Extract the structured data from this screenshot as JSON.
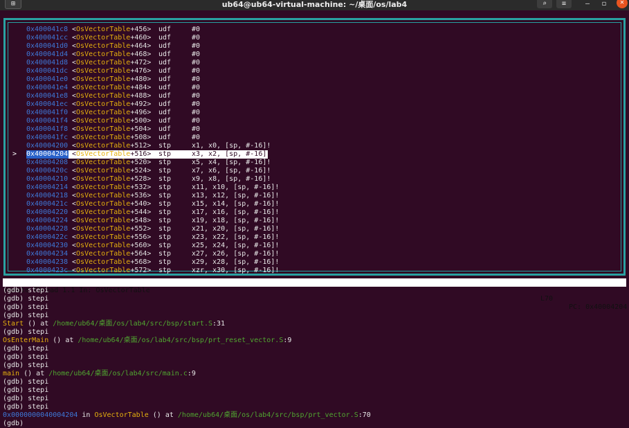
{
  "window": {
    "title": "ub64@ub64-virtual-machine: ~/桌面/os/lab4",
    "new_tab_glyph": "⊞",
    "search_glyph": "⌕",
    "menu_glyph": "≡",
    "minimize_glyph": "–",
    "maximize_glyph": "◻",
    "close_glyph": "✕"
  },
  "source_pane": {
    "marker": ">",
    "current_index": 15,
    "lines": [
      {
        "addr": "0x400041c8",
        "symbol": "OsVectorTable",
        "offset": "+456",
        "mnemonic": "udf",
        "operands": "#0"
      },
      {
        "addr": "0x400041cc",
        "symbol": "OsVectorTable",
        "offset": "+460",
        "mnemonic": "udf",
        "operands": "#0"
      },
      {
        "addr": "0x400041d0",
        "symbol": "OsVectorTable",
        "offset": "+464",
        "mnemonic": "udf",
        "operands": "#0"
      },
      {
        "addr": "0x400041d4",
        "symbol": "OsVectorTable",
        "offset": "+468",
        "mnemonic": "udf",
        "operands": "#0"
      },
      {
        "addr": "0x400041d8",
        "symbol": "OsVectorTable",
        "offset": "+472",
        "mnemonic": "udf",
        "operands": "#0"
      },
      {
        "addr": "0x400041dc",
        "symbol": "OsVectorTable",
        "offset": "+476",
        "mnemonic": "udf",
        "operands": "#0"
      },
      {
        "addr": "0x400041e0",
        "symbol": "OsVectorTable",
        "offset": "+480",
        "mnemonic": "udf",
        "operands": "#0"
      },
      {
        "addr": "0x400041e4",
        "symbol": "OsVectorTable",
        "offset": "+484",
        "mnemonic": "udf",
        "operands": "#0"
      },
      {
        "addr": "0x400041e8",
        "symbol": "OsVectorTable",
        "offset": "+488",
        "mnemonic": "udf",
        "operands": "#0"
      },
      {
        "addr": "0x400041ec",
        "symbol": "OsVectorTable",
        "offset": "+492",
        "mnemonic": "udf",
        "operands": "#0"
      },
      {
        "addr": "0x400041f0",
        "symbol": "OsVectorTable",
        "offset": "+496",
        "mnemonic": "udf",
        "operands": "#0"
      },
      {
        "addr": "0x400041f4",
        "symbol": "OsVectorTable",
        "offset": "+500",
        "mnemonic": "udf",
        "operands": "#0"
      },
      {
        "addr": "0x400041f8",
        "symbol": "OsVectorTable",
        "offset": "+504",
        "mnemonic": "udf",
        "operands": "#0"
      },
      {
        "addr": "0x400041fc",
        "symbol": "OsVectorTable",
        "offset": "+508",
        "mnemonic": "udf",
        "operands": "#0"
      },
      {
        "addr": "0x40004200",
        "symbol": "OsVectorTable",
        "offset": "+512",
        "mnemonic": "stp",
        "operands": "x1, x0, [sp, #-16]!"
      },
      {
        "addr": "0x40004204",
        "symbol": "OsVectorTable",
        "offset": "+516",
        "mnemonic": "stp",
        "operands": "x3, x2, [sp, #-16]!"
      },
      {
        "addr": "0x40004208",
        "symbol": "OsVectorTable",
        "offset": "+520",
        "mnemonic": "stp",
        "operands": "x5, x4, [sp, #-16]!"
      },
      {
        "addr": "0x4000420c",
        "symbol": "OsVectorTable",
        "offset": "+524",
        "mnemonic": "stp",
        "operands": "x7, x6, [sp, #-16]!"
      },
      {
        "addr": "0x40004210",
        "symbol": "OsVectorTable",
        "offset": "+528",
        "mnemonic": "stp",
        "operands": "x9, x8, [sp, #-16]!"
      },
      {
        "addr": "0x40004214",
        "symbol": "OsVectorTable",
        "offset": "+532",
        "mnemonic": "stp",
        "operands": "x11, x10, [sp, #-16]!"
      },
      {
        "addr": "0x40004218",
        "symbol": "OsVectorTable",
        "offset": "+536",
        "mnemonic": "stp",
        "operands": "x13, x12, [sp, #-16]!"
      },
      {
        "addr": "0x4000421c",
        "symbol": "OsVectorTable",
        "offset": "+540",
        "mnemonic": "stp",
        "operands": "x15, x14, [sp, #-16]!"
      },
      {
        "addr": "0x40004220",
        "symbol": "OsVectorTable",
        "offset": "+544",
        "mnemonic": "stp",
        "operands": "x17, x16, [sp, #-16]!"
      },
      {
        "addr": "0x40004224",
        "symbol": "OsVectorTable",
        "offset": "+548",
        "mnemonic": "stp",
        "operands": "x19, x18, [sp, #-16]!"
      },
      {
        "addr": "0x40004228",
        "symbol": "OsVectorTable",
        "offset": "+552",
        "mnemonic": "stp",
        "operands": "x21, x20, [sp, #-16]!"
      },
      {
        "addr": "0x4000422c",
        "symbol": "OsVectorTable",
        "offset": "+556",
        "mnemonic": "stp",
        "operands": "x23, x22, [sp, #-16]!"
      },
      {
        "addr": "0x40004230",
        "symbol": "OsVectorTable",
        "offset": "+560",
        "mnemonic": "stp",
        "operands": "x25, x24, [sp, #-16]!"
      },
      {
        "addr": "0x40004234",
        "symbol": "OsVectorTable",
        "offset": "+564",
        "mnemonic": "stp",
        "operands": "x27, x26, [sp, #-16]!"
      },
      {
        "addr": "0x40004238",
        "symbol": "OsVectorTable",
        "offset": "+568",
        "mnemonic": "stp",
        "operands": "x29, x28, [sp, #-16]!"
      },
      {
        "addr": "0x4000423c",
        "symbol": "OsVectorTable",
        "offset": "+572",
        "mnemonic": "stp",
        "operands": "xzr, x30, [sp, #-16]!"
      }
    ]
  },
  "status_bar": {
    "thread": "remote Thread 1.1 In: OsVectorTable",
    "line": "L70",
    "pc": "PC: 0x40004204"
  },
  "console": {
    "lines": [
      {
        "kind": "cmd",
        "prompt": "(gdb) ",
        "command": "stepi"
      },
      {
        "kind": "cmd",
        "prompt": "(gdb) ",
        "command": "stepi"
      },
      {
        "kind": "cmd",
        "prompt": "(gdb) ",
        "command": "stepi"
      },
      {
        "kind": "cmd",
        "prompt": "(gdb) ",
        "command": "stepi"
      },
      {
        "kind": "frame",
        "func": "Start",
        "mid": " () at ",
        "path": "/home/ub64/桌面/os/lab4/src/bsp/start.S",
        "tail": ":31"
      },
      {
        "kind": "cmd",
        "prompt": "(gdb) ",
        "command": "stepi"
      },
      {
        "kind": "frame",
        "func": "OsEnterMain",
        "mid": " () at ",
        "path": "/home/ub64/桌面/os/lab4/src/bsp/prt_reset_vector.S",
        "tail": ":9"
      },
      {
        "kind": "cmd",
        "prompt": "(gdb) ",
        "command": "stepi"
      },
      {
        "kind": "cmd",
        "prompt": "(gdb) ",
        "command": "stepi"
      },
      {
        "kind": "cmd",
        "prompt": "(gdb) ",
        "command": "stepi"
      },
      {
        "kind": "frame",
        "func": "main",
        "mid": " () at ",
        "path": "/home/ub64/桌面/os/lab4/src/main.c",
        "tail": ":9"
      },
      {
        "kind": "cmd",
        "prompt": "(gdb) ",
        "command": "stepi"
      },
      {
        "kind": "cmd",
        "prompt": "(gdb) ",
        "command": "stepi"
      },
      {
        "kind": "cmd",
        "prompt": "(gdb) ",
        "command": "stepi"
      },
      {
        "kind": "cmd",
        "prompt": "(gdb) ",
        "command": "stepi"
      },
      {
        "kind": "frameaddr",
        "addr": "0x0000000040004204",
        "pre": " in ",
        "func": "OsVectorTable",
        "mid": " () at ",
        "path": "/home/ub64/桌面/os/lab4/src/bsp/prt_vector.S",
        "tail": ":70"
      },
      {
        "kind": "cmd",
        "prompt": "(gdb) ",
        "command": ""
      }
    ]
  },
  "colors": {
    "terminal_bg": "#300a24",
    "frame_border": "#2aa1a1",
    "address": "#3e78d8",
    "symbol": "#e5b00e",
    "path": "#50a630",
    "close_button": "#e95420"
  }
}
